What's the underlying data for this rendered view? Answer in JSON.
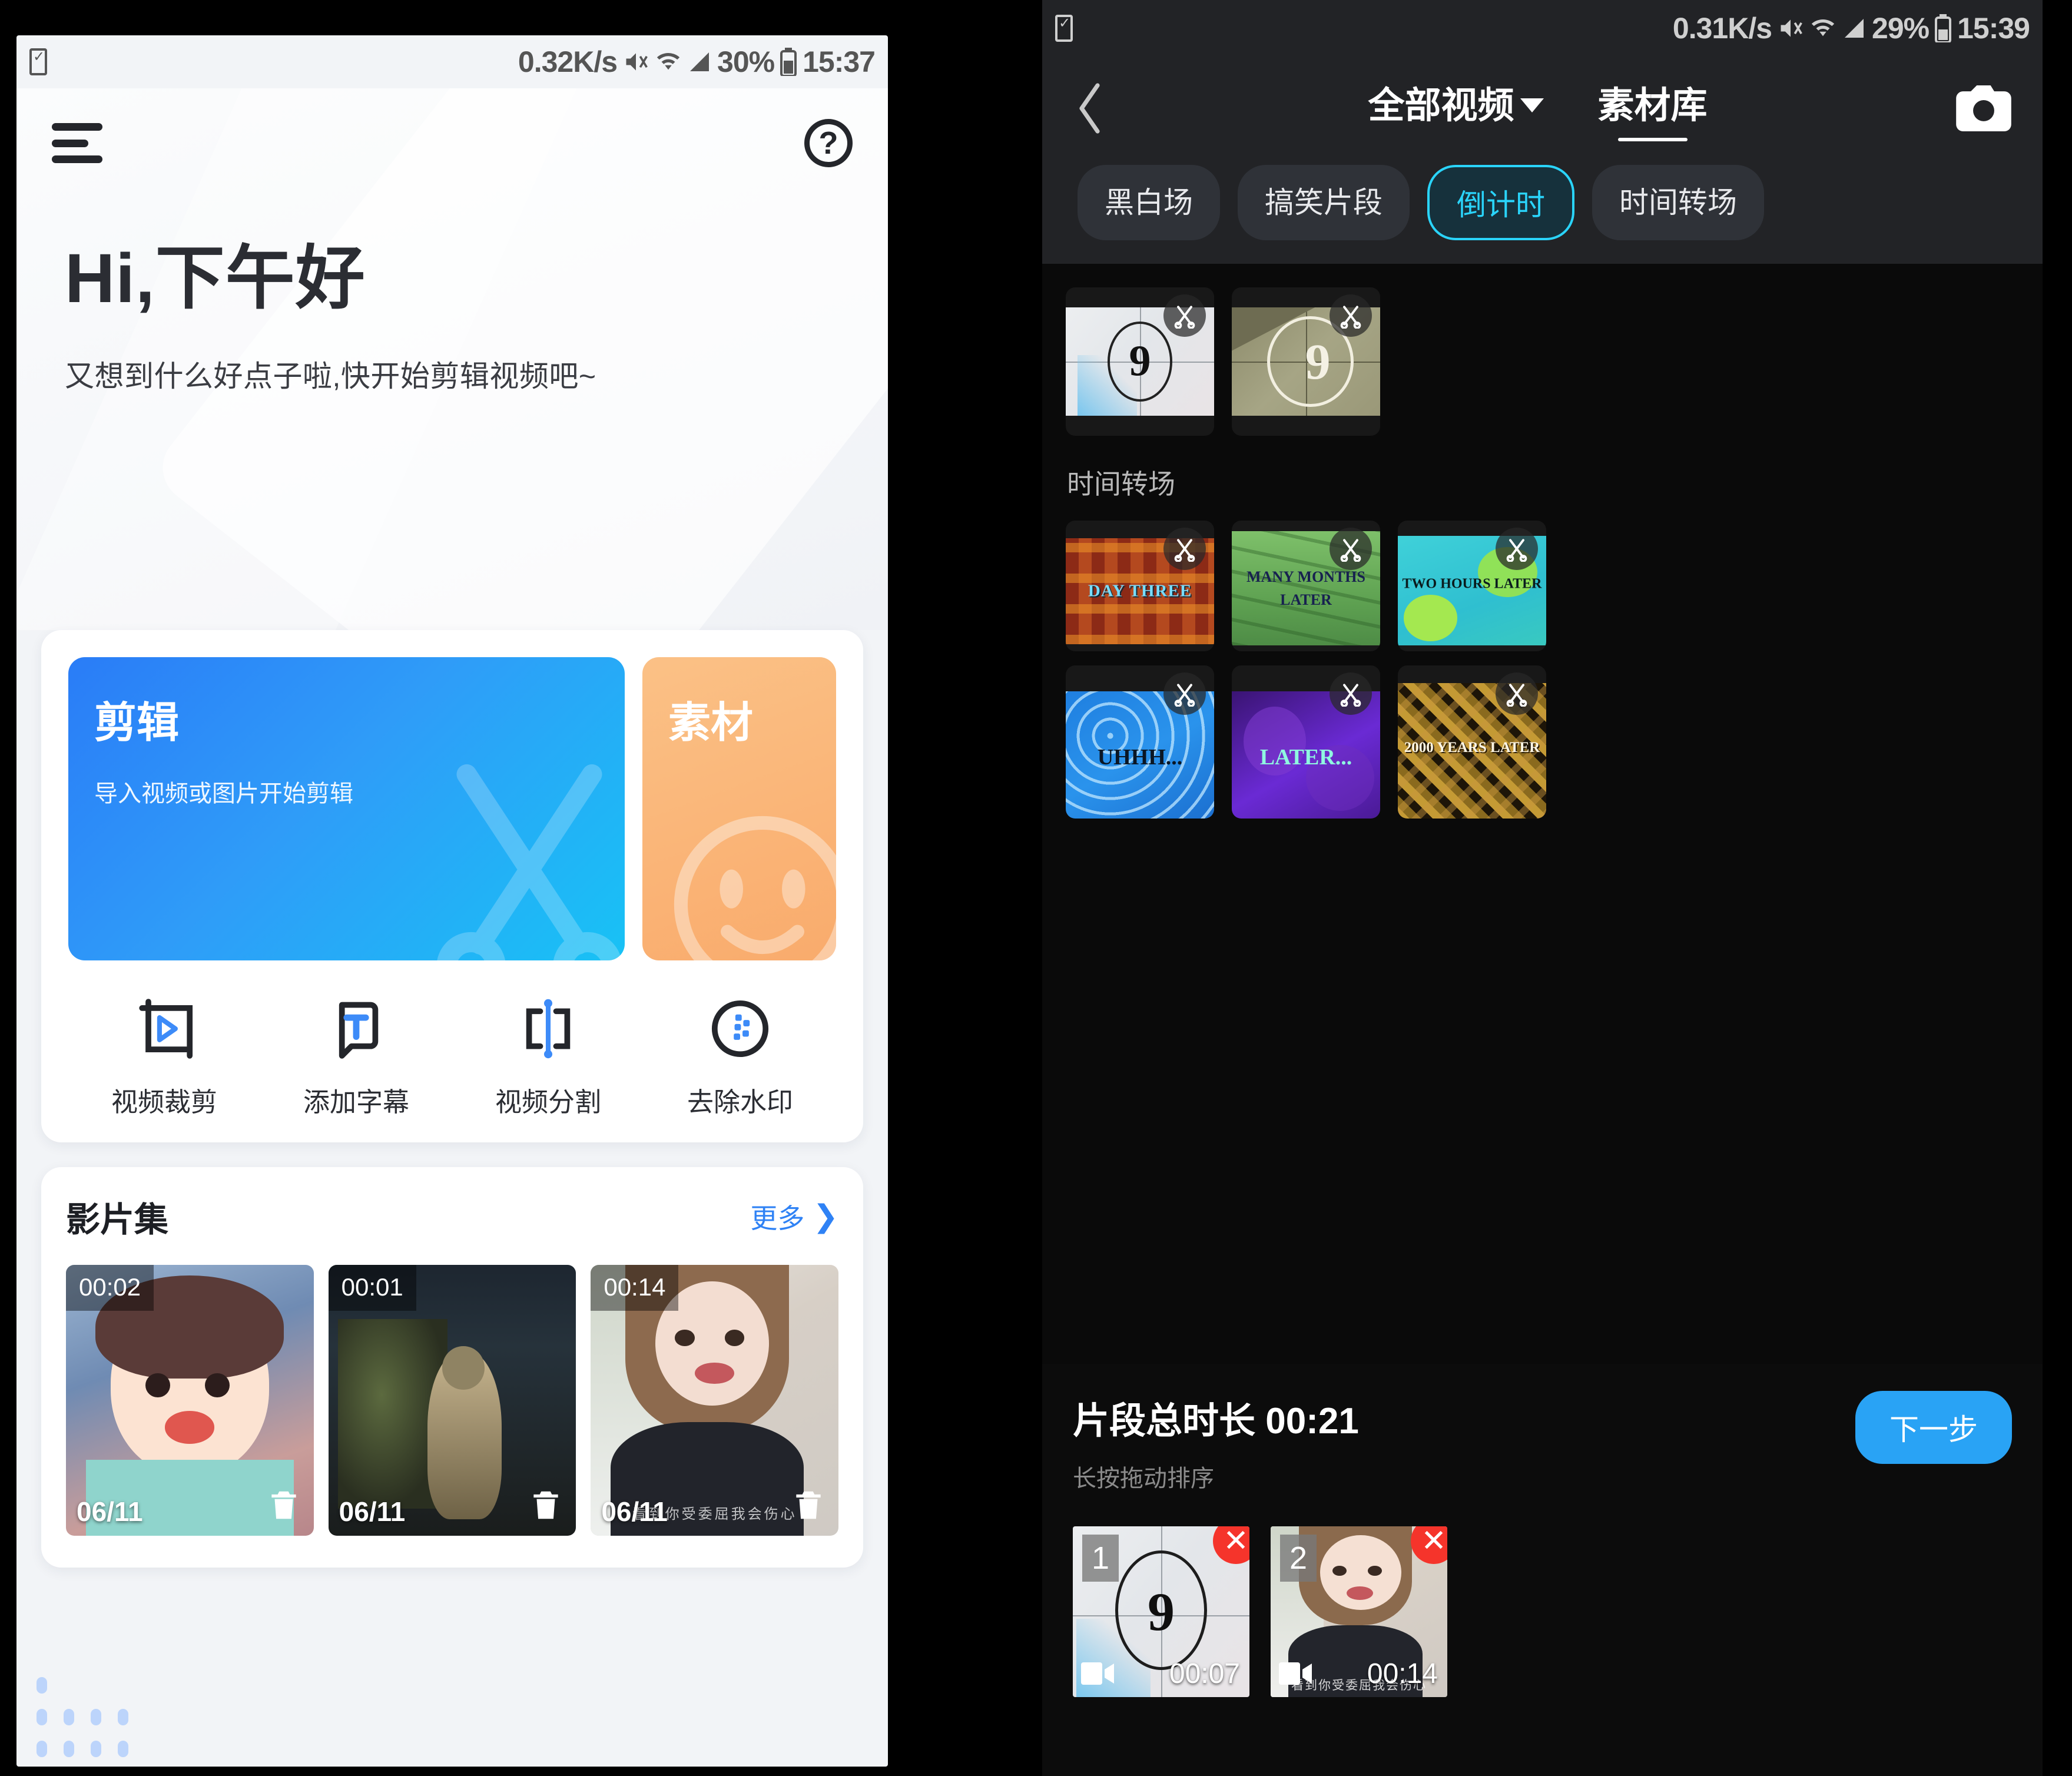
{
  "left": {
    "status": {
      "net_speed": "0.32K/s",
      "battery_pct": "30%",
      "time": "15:37"
    },
    "header": {
      "menu_icon": "hamburger-menu-icon",
      "help_icon": "help-circle-icon"
    },
    "greeting": {
      "title": "Hi,下午好",
      "subtitle": "又想到什么好点子啦,快开始剪辑视频吧~"
    },
    "tiles": [
      {
        "title": "剪辑",
        "subtitle": "导入视频或图片开始剪辑",
        "icon": "scissors-icon",
        "color": "#2a7cf7"
      },
      {
        "title": "素材",
        "subtitle": "",
        "icon": "smiley-icon",
        "color": "#f9ab6c"
      }
    ],
    "tools": [
      {
        "label": "视频裁剪",
        "icon": "video-crop-icon"
      },
      {
        "label": "添加字幕",
        "icon": "add-subtitle-icon"
      },
      {
        "label": "视频分割",
        "icon": "video-split-icon"
      },
      {
        "label": "去除水印",
        "icon": "remove-watermark-icon"
      }
    ],
    "films": {
      "title": "影片集",
      "more_label": "更多",
      "more_icon": "chevron-right-icon",
      "items": [
        {
          "duration": "00:02",
          "date": "06/11",
          "delete_icon": "trash-icon",
          "watermark": ""
        },
        {
          "duration": "00:01",
          "date": "06/11",
          "delete_icon": "trash-icon",
          "watermark": ""
        },
        {
          "duration": "00:14",
          "date": "06/11",
          "delete_icon": "trash-icon",
          "watermark": "看到你受委屈我会伤心"
        }
      ]
    }
  },
  "right": {
    "status": {
      "net_speed": "0.31K/s",
      "battery_pct": "29%",
      "time": "15:39"
    },
    "navbar": {
      "back_icon": "chevron-left-icon",
      "camera_icon": "camera-icon",
      "tabs": [
        {
          "label": "全部视频",
          "has_caret": true,
          "active": false
        },
        {
          "label": "素材库",
          "has_caret": false,
          "active": true
        }
      ]
    },
    "chips": [
      {
        "label": "黑白场",
        "active": false
      },
      {
        "label": "搞笑片段",
        "active": false
      },
      {
        "label": "倒计时",
        "active": true
      },
      {
        "label": "时间转场",
        "active": false
      }
    ],
    "accent_color": "#2ad4fb",
    "countdown_row": [
      {
        "caption": "9",
        "style": "leader-light",
        "cut_icon": "scissors-icon"
      },
      {
        "caption": "9",
        "style": "leader-olive",
        "cut_icon": "scissors-icon"
      }
    ],
    "section_label": "时间转场",
    "transition_rows": [
      [
        {
          "caption": "DAY THREE",
          "style": "tiki-red",
          "cut_icon": "scissors-icon"
        },
        {
          "caption": "MANY MONTHS LATER",
          "style": "palm-green",
          "cut_icon": "scissors-icon"
        },
        {
          "caption": "TWO HOURS LATER",
          "style": "flower-teal",
          "cut_icon": "scissors-icon"
        }
      ],
      [
        {
          "caption": "UHHH...",
          "style": "wave-blue",
          "cut_icon": "scissors-icon"
        },
        {
          "caption": "LATER...",
          "style": "flower-purple",
          "cut_icon": "scissors-icon"
        },
        {
          "caption": "2000 YEARS LATER",
          "style": "tribal-gold",
          "cut_icon": "scissors-icon"
        }
      ]
    ],
    "sheet": {
      "total_label": "片段总时长 00:21",
      "hint": "长按拖动排序",
      "next_label": "下一步",
      "clips": [
        {
          "index": "1",
          "duration": "00:07",
          "style": "leader-light",
          "remove_icon": "close-icon",
          "video_icon": "video-icon"
        },
        {
          "index": "2",
          "duration": "00:14",
          "style": "girl-photo",
          "remove_icon": "close-icon",
          "video_icon": "video-icon",
          "watermark": "看到你受委屈我会伤心"
        }
      ]
    }
  }
}
